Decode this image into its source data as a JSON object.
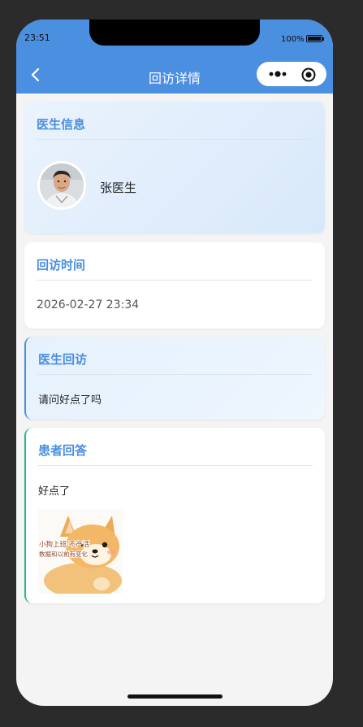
{
  "status_bar": {
    "time": "23:51",
    "battery": "100%"
  },
  "nav": {
    "title": "回访详情",
    "back_icon": "chevron-left-icon",
    "capsule_icons": [
      "more-dots-icon",
      "record-target-icon"
    ]
  },
  "doctor_info": {
    "section_title": "医生信息",
    "name": "张医生",
    "avatar": "doctor-avatar-photo"
  },
  "visit_time": {
    "section_title": "回访时间",
    "value": "2026-02-27 23:34"
  },
  "doctor_reply": {
    "section_title": "医生回访",
    "text": "请问好点了吗"
  },
  "patient_answer": {
    "section_title": "患者回答",
    "text": "好点了",
    "image": "cartoon-dog-image",
    "image_caption": "小狗上班·不产活 数据和以前有变化"
  },
  "colors": {
    "accent": "#4a8fe0",
    "answer_accent": "#26b98a",
    "page_bg": "#f4f4f4"
  }
}
